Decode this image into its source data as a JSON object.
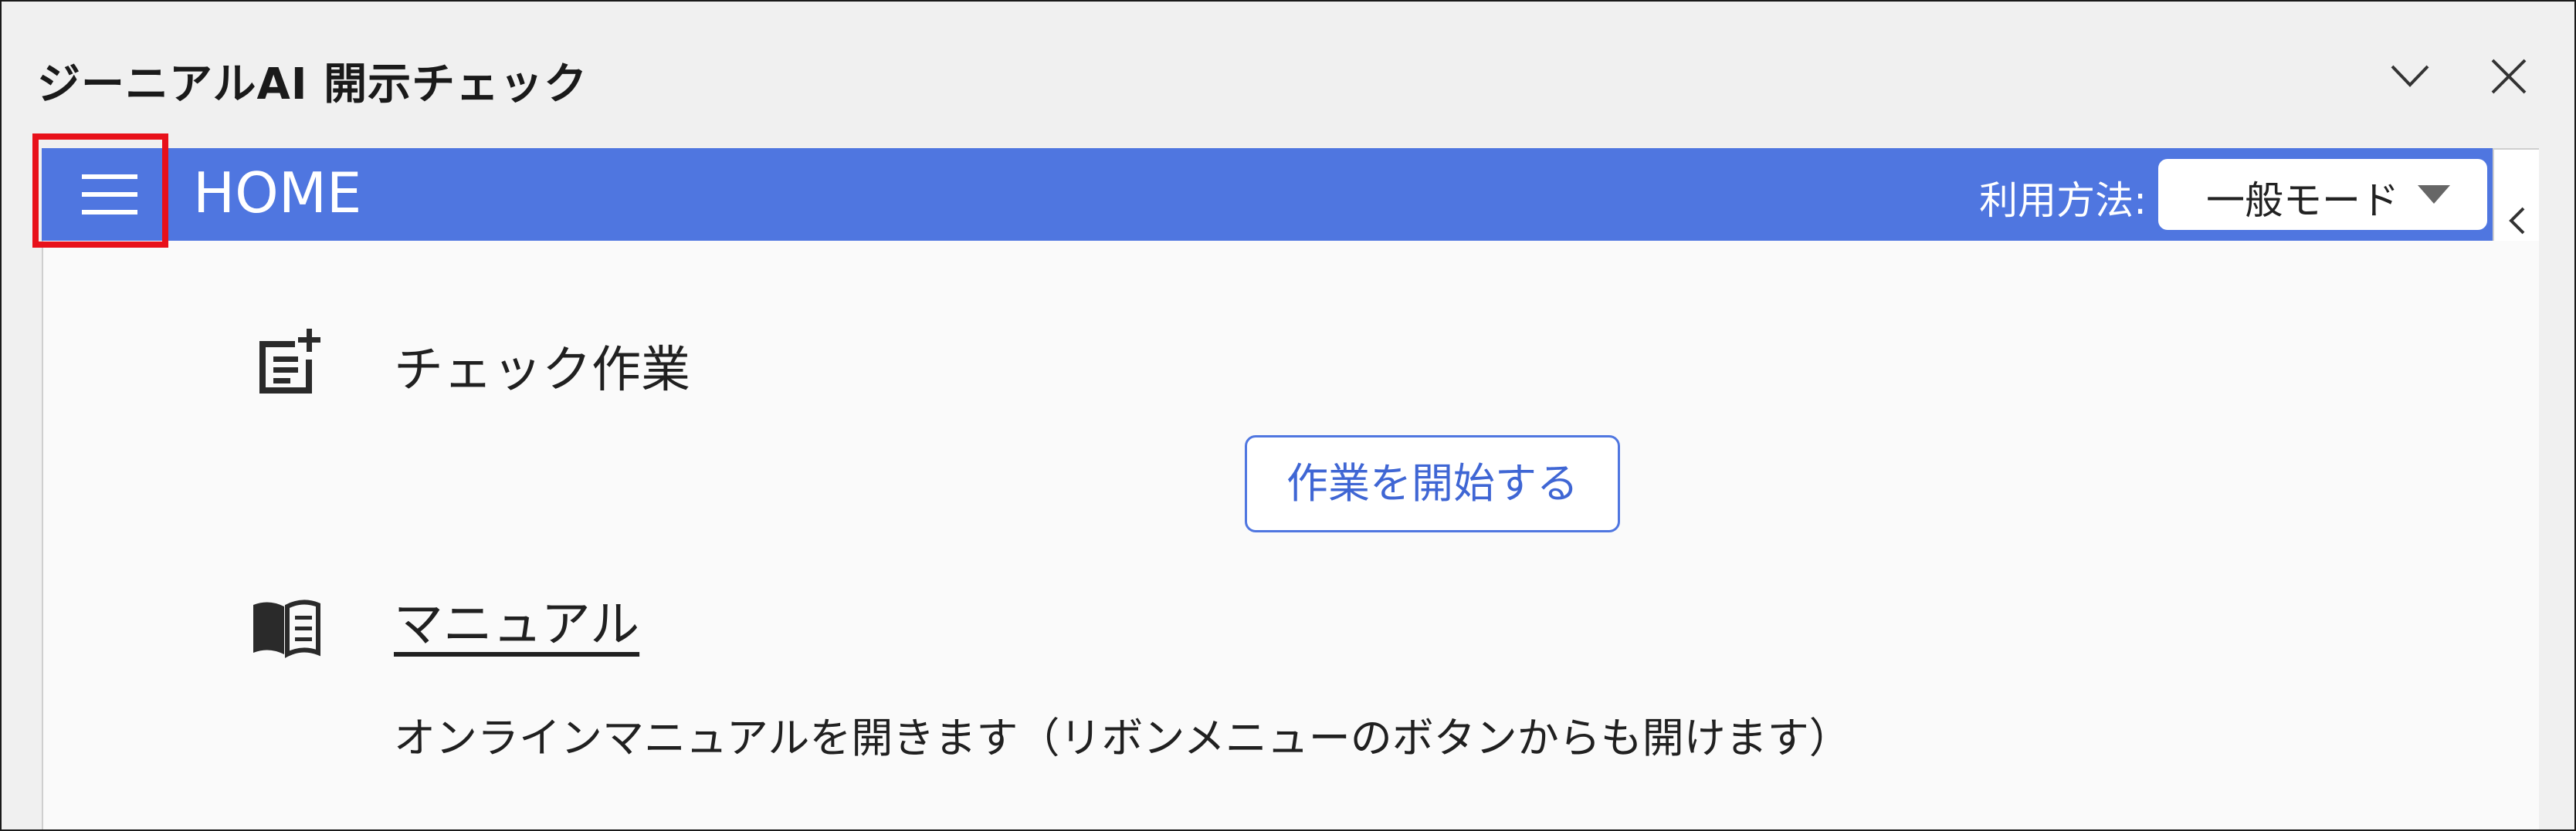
{
  "window": {
    "title": "ジーニアルAI 開示チェック",
    "collapse_icon": "chevron-down-icon",
    "close_icon": "close-icon"
  },
  "header": {
    "menu_icon": "hamburger-menu-icon",
    "title": "HOME",
    "usage_label": "利用方法:",
    "mode_select": {
      "value": "一般モード"
    },
    "accent_color": "#4f76e0",
    "highlight_color": "#e8101a"
  },
  "side_panel": {
    "toggle_icon": "chevron-left-icon"
  },
  "main": {
    "check_section": {
      "icon": "note-add-icon",
      "heading": "チェック作業",
      "start_button": "作業を開始する"
    },
    "manual_section": {
      "icon": "book-icon",
      "link": "マニュアル",
      "description": "オンラインマニュアルを開きます（リボンメニューのボタンからも開けます）"
    }
  }
}
